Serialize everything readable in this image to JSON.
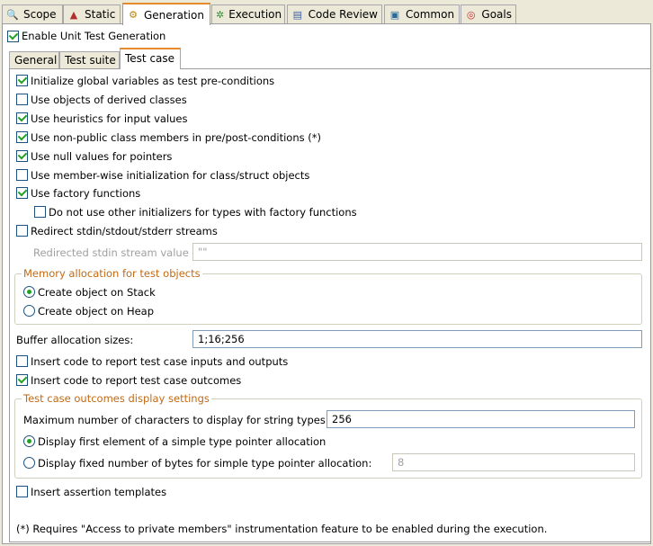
{
  "top_tabs": [
    {
      "label": "Scope",
      "icon": "magnifier-icon"
    },
    {
      "label": "Static",
      "icon": "static-analysis-icon"
    },
    {
      "label": "Generation",
      "icon": "gears-icon"
    },
    {
      "label": "Execution",
      "icon": "execution-icon"
    },
    {
      "label": "Code Review",
      "icon": "code-review-icon"
    },
    {
      "label": "Common",
      "icon": "common-icon"
    },
    {
      "label": "Goals",
      "icon": "target-icon"
    }
  ],
  "enable_unit_test": {
    "label": "Enable Unit Test Generation",
    "checked": true
  },
  "inner_tabs": [
    "General",
    "Test suite",
    "Test case"
  ],
  "options": {
    "init_globals": "Initialize global variables as test pre-conditions",
    "derived_classes": "Use objects of derived classes",
    "heuristics": "Use heuristics for input values",
    "non_public": "Use non-public class members in pre/post-conditions (*)",
    "null_values": "Use null values for pointers",
    "member_wise": "Use member-wise initialization for class/struct objects",
    "factory": "Use factory functions",
    "no_other_init": "Do not use other initializers for types with factory functions",
    "redirect": "Redirect stdin/stdout/stderr streams",
    "redirected_label": "Redirected stdin stream value",
    "redirected_value": "\"\""
  },
  "memory": {
    "title": "Memory allocation for test objects",
    "stack": "Create object on Stack",
    "heap": "Create object on Heap"
  },
  "buffer": {
    "label": "Buffer allocation sizes:",
    "value": "1;16;256"
  },
  "report": {
    "inputs_outputs": "Insert code to report test case inputs and outputs",
    "outcomes": "Insert code to report test case outcomes"
  },
  "outcomes_group": {
    "title": "Test case outcomes display settings",
    "max_chars_label": "Maximum number of characters to display for string types:",
    "max_chars_value": "256",
    "first_element": "Display first element of a simple type pointer allocation",
    "fixed_bytes": "Display fixed number of bytes for simple type pointer allocation:",
    "fixed_bytes_value": "8"
  },
  "assertion": "Insert assertion templates",
  "footnote": "(*) Requires \"Access to private members\" instrumentation feature to be enabled during the execution.",
  "colors": {
    "accent_tab": "#e68b2c",
    "group_title": "#c06a14",
    "check": "#21a121"
  }
}
